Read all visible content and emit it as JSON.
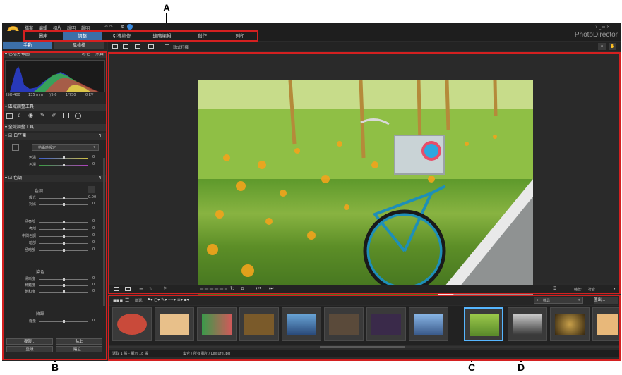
{
  "callouts": {
    "a": "A",
    "b": "B",
    "c": "C",
    "d": "D"
  },
  "menu": {
    "file": "檔案",
    "edit": "編輯",
    "photo": "相片",
    "help": "說明",
    "help2": "說明"
  },
  "modes": [
    "圖庫",
    "調整",
    "引導編修",
    "進階編輯",
    "創作",
    "列印"
  ],
  "active_mode": "調整",
  "brand": "PhotoDirector",
  "left_tabs": {
    "manual": "手動",
    "presets": "風格檔"
  },
  "histogram": {
    "title": "色階分布圖",
    "color": "彩色",
    "bw": "黑白",
    "iso": "ISO 400",
    "focal": "135 mm",
    "aperture": "f/5.6",
    "shutter": "1/750",
    "ev": "0 EV"
  },
  "regional_tools": {
    "title": "區域調整工具"
  },
  "global_tools": {
    "title": "全域調整工具"
  },
  "white_balance": {
    "title": "白平衡",
    "preset": "拍攝時設定",
    "rows": [
      {
        "label": "色溫",
        "value": "0"
      },
      {
        "label": "色澤",
        "value": "0"
      }
    ]
  },
  "tone": {
    "title": "色調",
    "subtitle": "色調",
    "rows1": [
      {
        "label": "曝光",
        "value": "0.00"
      },
      {
        "label": "對比",
        "value": "0"
      }
    ],
    "rows2": [
      {
        "label": "極亮部",
        "value": "0"
      },
      {
        "label": "亮部",
        "value": "0"
      },
      {
        "label": "中間色調",
        "value": "0"
      },
      {
        "label": "暗部",
        "value": "0"
      },
      {
        "label": "極暗部",
        "value": "0"
      }
    ],
    "color_section": "染色",
    "rows3": [
      {
        "label": "清晰度",
        "value": "0"
      },
      {
        "label": "鮮豔度",
        "value": "0"
      },
      {
        "label": "飽和度",
        "value": "0"
      }
    ],
    "sharpen_section": "降躁",
    "rows4": [
      {
        "label": "縮量",
        "value": "0"
      }
    ]
  },
  "left_buttons": {
    "copy": "複製...",
    "paste": "貼上",
    "reset": "重設",
    "create": "建立..."
  },
  "top_toolbar": {
    "softproof": "軟式打樣"
  },
  "bottom_toolbar": {
    "zoom_label": "縮放:",
    "zoom_value": "符合"
  },
  "filmstrip": {
    "filter_label": "篩選:",
    "search_placeholder": "搜尋",
    "export": "匯出..."
  },
  "status": {
    "left": "選取 1 張 - 顯示 18 張",
    "right": "集合 / 所有相片 / Leisure.jpg"
  }
}
